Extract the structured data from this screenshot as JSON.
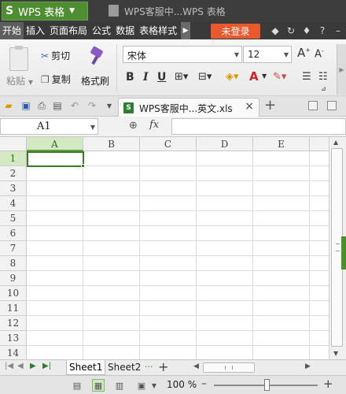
{
  "titlebar": {
    "app_logo": "S",
    "app_name": "WPS 表格",
    "doc_title": "WPS客服中...WPS 表格"
  },
  "menu": {
    "items": [
      "开始",
      "插入",
      "页面布局",
      "公式",
      "数据",
      "表格样式"
    ],
    "login_label": "未登录",
    "right_icons": [
      "skin-icon",
      "refresh-icon",
      "shirt-icon",
      "help-icon",
      "minimize-icon"
    ]
  },
  "ribbon": {
    "paste_label": "粘贴",
    "cut_label": "剪切",
    "copy_label": "复制",
    "format_painter_label": "格式刷",
    "font_name": "宋体",
    "font_size": "12",
    "bold": "B",
    "italic": "I",
    "underline": "U"
  },
  "docbar": {
    "tab_label": "WPS客服中...英文.xls",
    "xls_icon_text": "S"
  },
  "formula": {
    "cell_ref": "A1",
    "fx": "fx",
    "value": ""
  },
  "grid": {
    "columns": [
      "A",
      "B",
      "C",
      "D",
      "E"
    ],
    "rows": [
      "1",
      "2",
      "3",
      "4",
      "5",
      "6",
      "7",
      "8",
      "9",
      "10",
      "11",
      "12",
      "13",
      "14"
    ],
    "active_cell": "A1"
  },
  "sheets": {
    "tabs": [
      "Sheet1",
      "Sheet2"
    ],
    "active": "Sheet1",
    "more": "···"
  },
  "status": {
    "zoom_label": "100 %",
    "zoom_percent": 100
  },
  "colors": {
    "accent_green": "#4f8d32",
    "login_orange": "#e8592e",
    "titlebar_dark": "#3d3d3d"
  }
}
